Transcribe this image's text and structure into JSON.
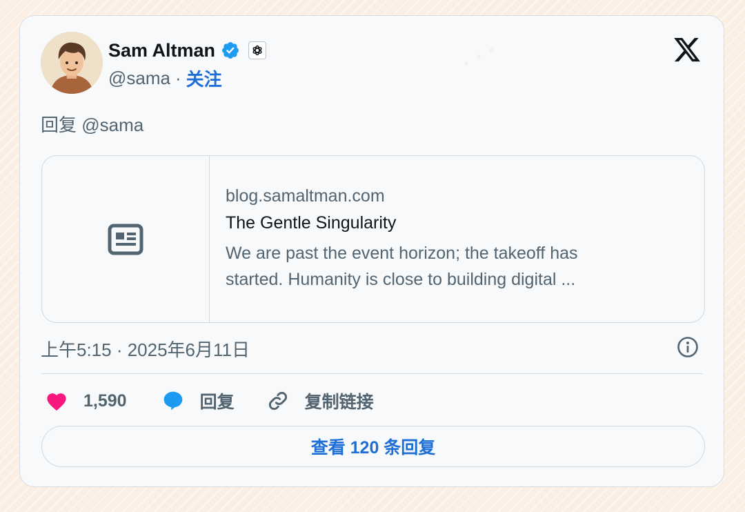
{
  "author": {
    "name": "Sam Altman",
    "handle": "@sama",
    "separator": "·",
    "follow_label": "关注"
  },
  "icons": {
    "close": "x-logo-icon",
    "verified": "verified-badge-icon",
    "affiliate": "openai-logo-icon",
    "link_thumbnail": "newspaper-icon",
    "info": "info-icon",
    "like": "heart-icon",
    "reply": "speech-bubble-icon",
    "copy_link": "link-icon"
  },
  "tweet": {
    "reply_to": "回复 @sama",
    "timestamp": "上午5:15 · 2025年6月11日"
  },
  "link_card": {
    "domain": "blog.samaltman.com",
    "title": "The Gentle Singularity",
    "description_line1": "We are past the event horizon; the takeoff has",
    "description_line2": "started. Humanity is close to building digital ..."
  },
  "actions": {
    "like_count": "1,590",
    "reply_label": "回复",
    "copy_link_label": "复制链接"
  },
  "view_replies_label": "查看 120 条回复",
  "colors": {
    "accent": "#1d6fd6",
    "verified": "#1d9bf0",
    "like": "#f91880",
    "text_primary": "#0f1419",
    "text_secondary": "#536471",
    "card_bg": "#f7f9fa",
    "page_bg": "#fbeee2"
  }
}
